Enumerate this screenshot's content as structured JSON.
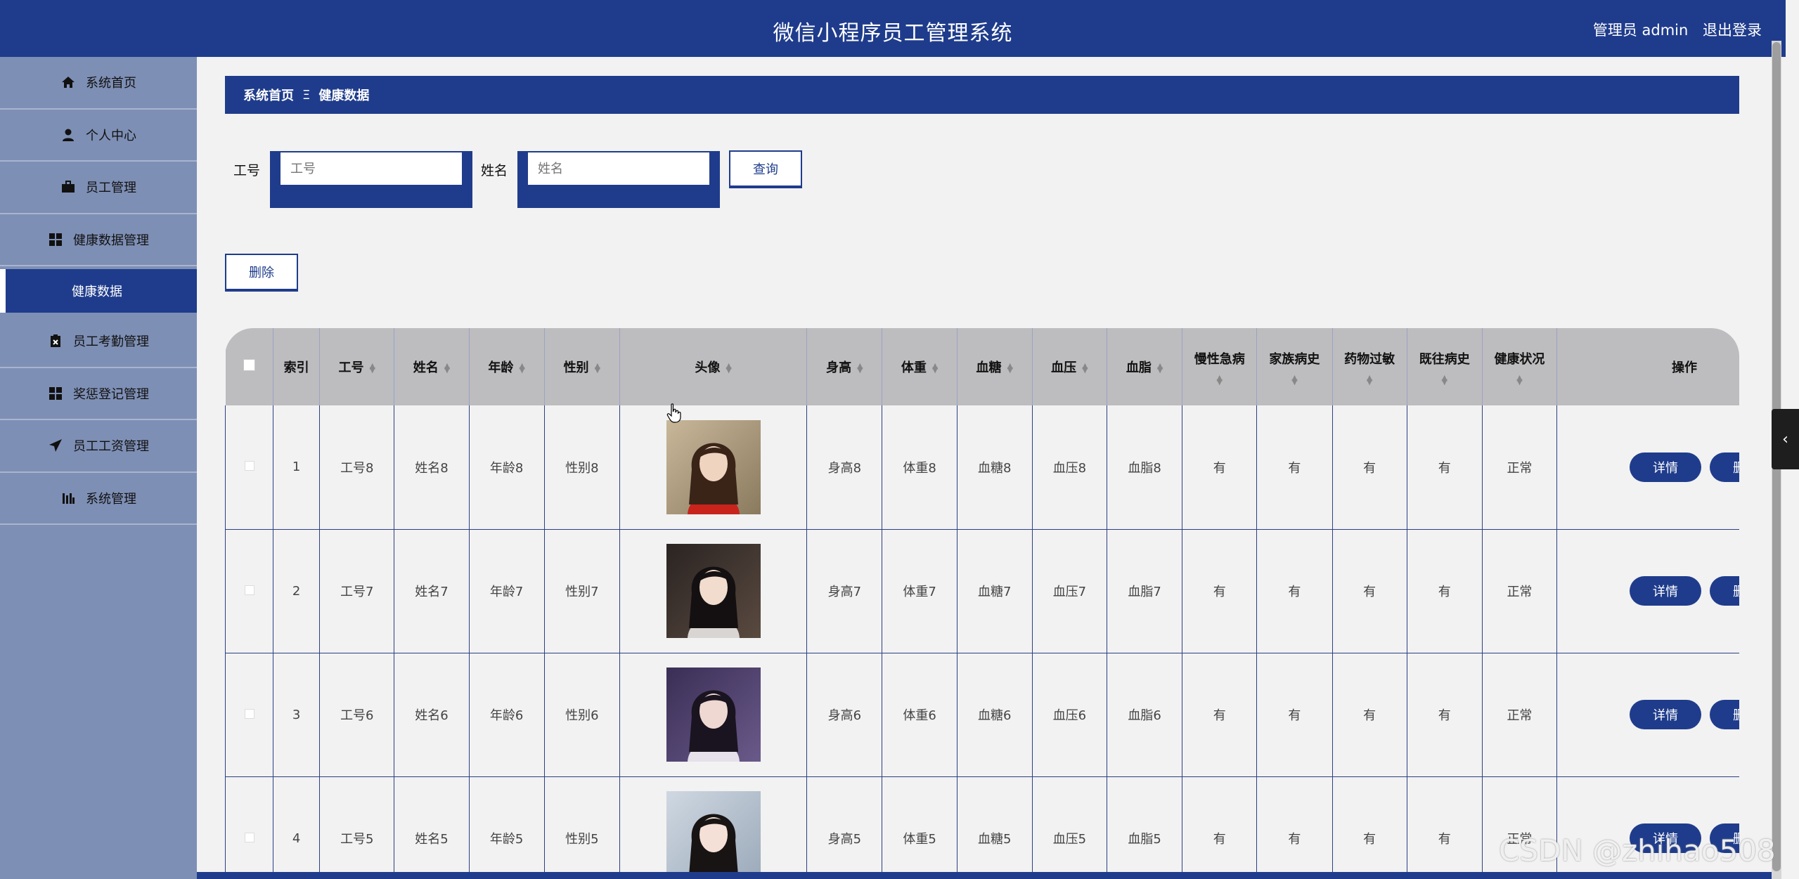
{
  "header": {
    "title": "微信小程序员工管理系统",
    "user": "管理员 admin",
    "logout": "退出登录"
  },
  "sidebar": {
    "items": [
      {
        "label": "系统首页",
        "icon": "home-icon"
      },
      {
        "label": "个人中心",
        "icon": "user-icon"
      },
      {
        "label": "员工管理",
        "icon": "briefcase-icon"
      },
      {
        "label": "健康数据管理",
        "icon": "grid-icon"
      },
      {
        "label": "健康数据",
        "icon": ""
      },
      {
        "label": "员工考勤管理",
        "icon": "clipboard-icon"
      },
      {
        "label": "奖惩登记管理",
        "icon": "grid-icon"
      },
      {
        "label": "员工工资管理",
        "icon": "send-icon"
      },
      {
        "label": "系统管理",
        "icon": "chart-icon"
      }
    ]
  },
  "breadcrumb": {
    "home": "系统首页",
    "separator": "Ξ",
    "current": "健康数据"
  },
  "search": {
    "id_label": "工号",
    "id_placeholder": "工号",
    "name_label": "姓名",
    "name_placeholder": "姓名",
    "query_button": "查询"
  },
  "actions": {
    "delete_button": "删除"
  },
  "table": {
    "headers": [
      "",
      "索引",
      "工号",
      "姓名",
      "年龄",
      "性别",
      "头像",
      "身高",
      "体重",
      "血糖",
      "血压",
      "血脂",
      "慢性急病",
      "家族病史",
      "药物过敏",
      "既往病史",
      "健康状况",
      "操作"
    ],
    "rows": [
      {
        "index": "1",
        "id": "工号8",
        "name": "姓名8",
        "age": "年龄8",
        "gender": "性别8",
        "height": "身高8",
        "weight": "体重8",
        "sugar": "血糖8",
        "pressure": "血压8",
        "lipid": "血脂8",
        "chronic": "有",
        "family": "有",
        "allergy": "有",
        "history": "有",
        "status": "正常",
        "detail": "详情",
        "delete": "删除"
      },
      {
        "index": "2",
        "id": "工号7",
        "name": "姓名7",
        "age": "年龄7",
        "gender": "性别7",
        "height": "身高7",
        "weight": "体重7",
        "sugar": "血糖7",
        "pressure": "血压7",
        "lipid": "血脂7",
        "chronic": "有",
        "family": "有",
        "allergy": "有",
        "history": "有",
        "status": "正常",
        "detail": "详情",
        "delete": "删除"
      },
      {
        "index": "3",
        "id": "工号6",
        "name": "姓名6",
        "age": "年龄6",
        "gender": "性别6",
        "height": "身高6",
        "weight": "体重6",
        "sugar": "血糖6",
        "pressure": "血压6",
        "lipid": "血脂6",
        "chronic": "有",
        "family": "有",
        "allergy": "有",
        "history": "有",
        "status": "正常",
        "detail": "详情",
        "delete": "删除"
      },
      {
        "index": "4",
        "id": "工号5",
        "name": "姓名5",
        "age": "年龄5",
        "gender": "性别5",
        "height": "身高5",
        "weight": "体重5",
        "sugar": "血糖5",
        "pressure": "血压5",
        "lipid": "血脂5",
        "chronic": "有",
        "family": "有",
        "allergy": "有",
        "history": "有",
        "status": "正常",
        "detail": "详情",
        "delete": "删除"
      }
    ]
  },
  "watermark": "CSDN @zhihao508",
  "colors": {
    "primary": "#1f3c8c",
    "sidebar": "#7e8fb5",
    "header_row": "#bdbcbf"
  }
}
